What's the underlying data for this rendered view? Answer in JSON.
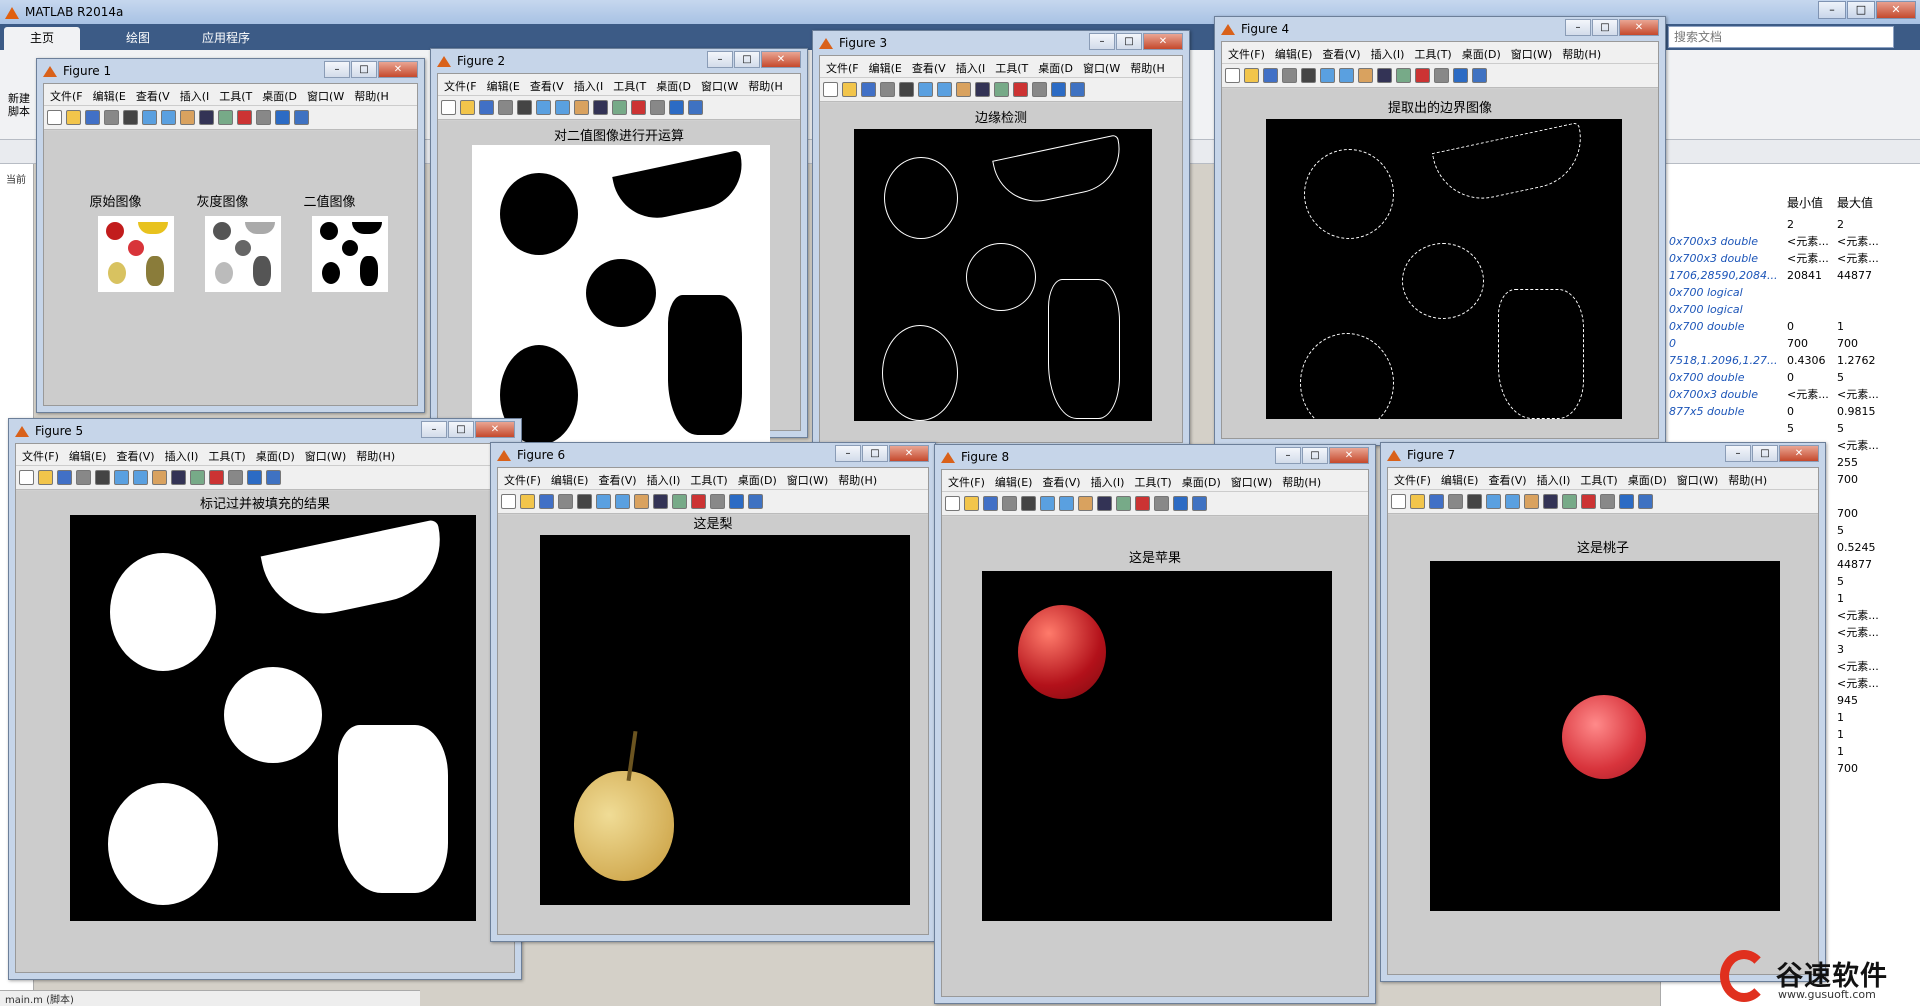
{
  "app": {
    "title": "MATLAB R2014a",
    "tabs": [
      "主页",
      "绘图",
      "应用程序"
    ],
    "search_placeholder": "搜索文档",
    "new_script_label": "新建\n脚本",
    "current_folder_label": "当前",
    "bottom_file": "main.m (脚本)",
    "accent_color": "#3c5b86"
  },
  "workspace": {
    "header_min": "最小值",
    "header_max": "最大值",
    "rows": [
      {
        "type": "",
        "min": "2",
        "max": "2"
      },
      {
        "type": "0x700x3 double",
        "min": "<元素...",
        "max": "<元素..."
      },
      {
        "type": "0x700x3 double",
        "min": "<元素...",
        "max": "<元素..."
      },
      {
        "type": "1706,28590,2084...",
        "min": "20841",
        "max": "44877"
      },
      {
        "type": "0x700 logical",
        "min": "",
        "max": ""
      },
      {
        "type": "0x700 logical",
        "min": "",
        "max": ""
      },
      {
        "type": "0x700 double",
        "min": "0",
        "max": "1"
      },
      {
        "type": "0",
        "min": "700",
        "max": "700"
      },
      {
        "type": "7518,1.2096,1.27...",
        "min": "0.4306",
        "max": "1.2762"
      },
      {
        "type": "0x700 double",
        "min": "0",
        "max": "5"
      },
      {
        "type": "0x700x3 double",
        "min": "<元素...",
        "max": "<元素..."
      },
      {
        "type": "877x5 double",
        "min": "0",
        "max": "0.9815"
      },
      {
        "type": "",
        "min": "5",
        "max": "5"
      },
      {
        "type": "",
        "min": "",
        "max": "<元素..."
      },
      {
        "type": "",
        "min": "",
        "max": "255"
      },
      {
        "type": "",
        "min": "",
        "max": "700"
      },
      {
        "type": "",
        "min": "",
        "max": ""
      },
      {
        "type": "",
        "min": "",
        "max": "700"
      },
      {
        "type": "",
        "min": "",
        "max": "5"
      },
      {
        "type": "",
        "min": "",
        "max": "0.5245"
      },
      {
        "type": "",
        "min": "",
        "max": "44877"
      },
      {
        "type": "",
        "min": "",
        "max": "5"
      },
      {
        "type": "",
        "min": "",
        "max": "1"
      },
      {
        "type": "",
        "min": "",
        "max": "<元素..."
      },
      {
        "type": "",
        "min": "",
        "max": "<元素..."
      },
      {
        "type": "",
        "min": "",
        "max": "3"
      },
      {
        "type": "",
        "min": "",
        "max": "<元素..."
      },
      {
        "type": "",
        "min": "",
        "max": "<元素..."
      },
      {
        "type": "",
        "min": "",
        "max": "945"
      },
      {
        "type": "",
        "min": "",
        "max": "1"
      },
      {
        "type": "",
        "min": "",
        "max": "1"
      },
      {
        "type": "",
        "min": "",
        "max": "1"
      },
      {
        "type": "",
        "min": "",
        "max": "700"
      }
    ]
  },
  "menus": {
    "full": [
      "文件(F)",
      "编辑(E)",
      "查看(V)",
      "插入(I)",
      "工具(T)",
      "桌面(D)",
      "窗口(W)",
      "帮助(H)"
    ],
    "narrow": [
      "文件(F",
      "编辑(E",
      "查看(V",
      "插入(I",
      "工具(T",
      "桌面(D",
      "窗口(W",
      "帮助(H"
    ]
  },
  "figures": {
    "f1": {
      "title": "Figure 1",
      "labels": [
        "原始图像",
        "灰度图像",
        "二值图像"
      ]
    },
    "f2": {
      "title": "Figure 2",
      "plot_title": "对二值图像进行开运算"
    },
    "f3": {
      "title": "Figure 3",
      "plot_title": "边缘检测"
    },
    "f4": {
      "title": "Figure 4",
      "plot_title": "提取出的边界图像"
    },
    "f5": {
      "title": "Figure 5",
      "plot_title": "标记过并被填充的结果"
    },
    "f6": {
      "title": "Figure 6",
      "plot_title": "这是梨"
    },
    "f8": {
      "title": "Figure 8",
      "plot_title": "这是苹果"
    },
    "f7": {
      "title": "Figure 7",
      "plot_title": "这是桃子"
    }
  },
  "watermark": {
    "name": "谷速软件",
    "url": "www.gusuoft.com"
  }
}
